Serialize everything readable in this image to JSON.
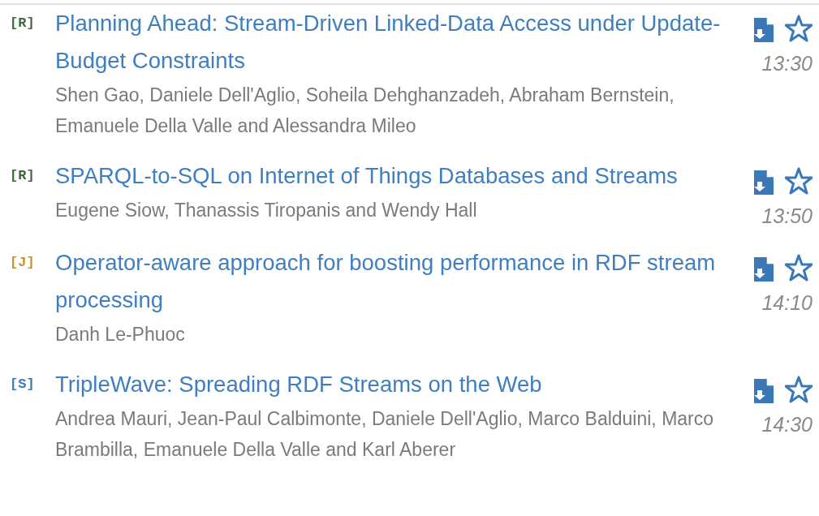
{
  "papers": [
    {
      "tag": "[R]",
      "color": "#3f6b3a",
      "title": "Planning Ahead: Stream-Driven Linked-Data Access under Update-Budget Constraints",
      "authors": "Shen Gao, Daniele Dell'Aglio, Soheila Dehghanzadeh, Abraham Bernstein, Emanuele Della Valle and Alessandra Mileo",
      "time": "13:30",
      "starred": false
    },
    {
      "tag": "[R]",
      "color": "#3f6b3a",
      "title": "SPARQL-to-SQL on Internet of Things Databases and Streams",
      "authors": "Eugene Siow, Thanassis Tiropanis and Wendy Hall",
      "time": "13:50",
      "starred": false
    },
    {
      "tag": "[J]",
      "color": "#c8922e",
      "title": "Operator-aware approach for boosting performance in RDF stream processing",
      "authors": "Danh Le-Phuoc",
      "time": "14:10",
      "starred": false
    },
    {
      "tag": "[S]",
      "color": "#3a7bbf",
      "title": "TripleWave: Spreading RDF Streams on the Web",
      "authors": "Andrea Mauri, Jean-Paul Calbimonte, Daniele Dell'Aglio, Marco Balduini, Marco Brambilla, Emanuele Della Valle and Karl Aberer",
      "time": "14:30",
      "starred": false
    }
  ]
}
